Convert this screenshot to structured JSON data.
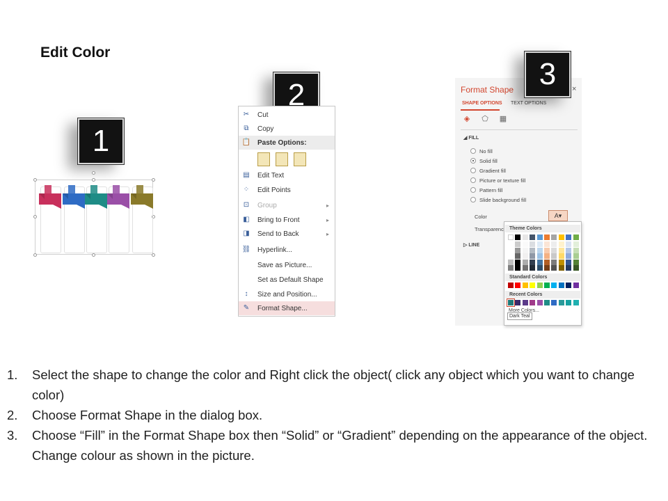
{
  "title": "Edit Color",
  "badges": {
    "one": "1",
    "two": "2",
    "three": "3"
  },
  "shapes": {
    "colors": [
      "#c8305c",
      "#2e6bc4",
      "#1e8c86",
      "#9a4fa7",
      "#8a7a2a"
    ]
  },
  "context_menu": {
    "items": [
      {
        "label": "Cut",
        "icon": "scissors-icon",
        "glyph": "✂"
      },
      {
        "label": "Copy",
        "icon": "copy-icon",
        "glyph": "⧉"
      }
    ],
    "paste_header": "Paste Options:",
    "items2": [
      {
        "label": "Edit Text",
        "icon": "edit-text-icon",
        "glyph": "▤"
      },
      {
        "label": "Edit Points",
        "icon": "edit-points-icon",
        "glyph": "⁘"
      },
      {
        "label": "Group",
        "icon": "group-icon",
        "glyph": "⊡",
        "disabled": true,
        "submenu": true
      },
      {
        "label": "Bring to Front",
        "icon": "bring-front-icon",
        "glyph": "◧",
        "submenu": true
      },
      {
        "label": "Send to Back",
        "icon": "send-back-icon",
        "glyph": "◨",
        "submenu": true
      },
      {
        "label": "Hyperlink...",
        "icon": "hyperlink-icon",
        "glyph": "⛓"
      },
      {
        "label": "Save as Picture...",
        "icon": "",
        "glyph": ""
      },
      {
        "label": "Set as Default Shape",
        "icon": "",
        "glyph": ""
      },
      {
        "label": "Size and Position...",
        "icon": "size-position-icon",
        "glyph": "↕"
      },
      {
        "label": "Format Shape...",
        "icon": "format-shape-icon",
        "glyph": "✎",
        "highlight": true
      }
    ]
  },
  "format_pane": {
    "title": "Format Shape",
    "close": "×",
    "tab_shape": "SHAPE OPTIONS",
    "tab_text": "TEXT OPTIONS",
    "fill_label": "FILL",
    "fill_options": [
      "No fill",
      "Solid fill",
      "Gradient fill",
      "Picture or texture fill",
      "Pattern fill",
      "Slide background fill"
    ],
    "selected_fill": "Solid fill",
    "color_label": "Color",
    "transparency_label": "Transparency",
    "line_label": "LINE",
    "color_button": "A▾"
  },
  "color_dropdown": {
    "theme_label": "Theme Colors",
    "standard_label": "Standard Colors",
    "recent_label": "Recent Colors",
    "more": "More Colors...",
    "tooltip": "Dark Teal",
    "theme_top": [
      "#ffffff",
      "#000000",
      "#e7e6e6",
      "#44546a",
      "#5b9bd5",
      "#ed7d31",
      "#a5a5a5",
      "#ffc000",
      "#4472c4",
      "#70ad47"
    ],
    "standard": [
      "#c00000",
      "#ff0000",
      "#ffc000",
      "#ffff00",
      "#92d050",
      "#00b050",
      "#00b0f0",
      "#0070c0",
      "#002060",
      "#7030a0"
    ],
    "recent": [
      "#1f7a7a",
      "#3b2a6b",
      "#5b3a8a",
      "#a03a8a",
      "#9b4fa8",
      "#1f8c86",
      "#2e6bc4",
      "#2a9a9a",
      "#16a0a0",
      "#1fb0b0"
    ]
  },
  "instructions": [
    {
      "num": "1.",
      "text": "Select the shape to change the color and Right click the object( click any object which you want to change color)"
    },
    {
      "num": "2.",
      "text": "Choose Format Shape in the dialog box."
    },
    {
      "num": "3.",
      "text": "Choose “Fill” in the Format Shape box then “Solid” or “Gradient” depending on the appearance of the object. Change colour as shown in the picture."
    }
  ]
}
